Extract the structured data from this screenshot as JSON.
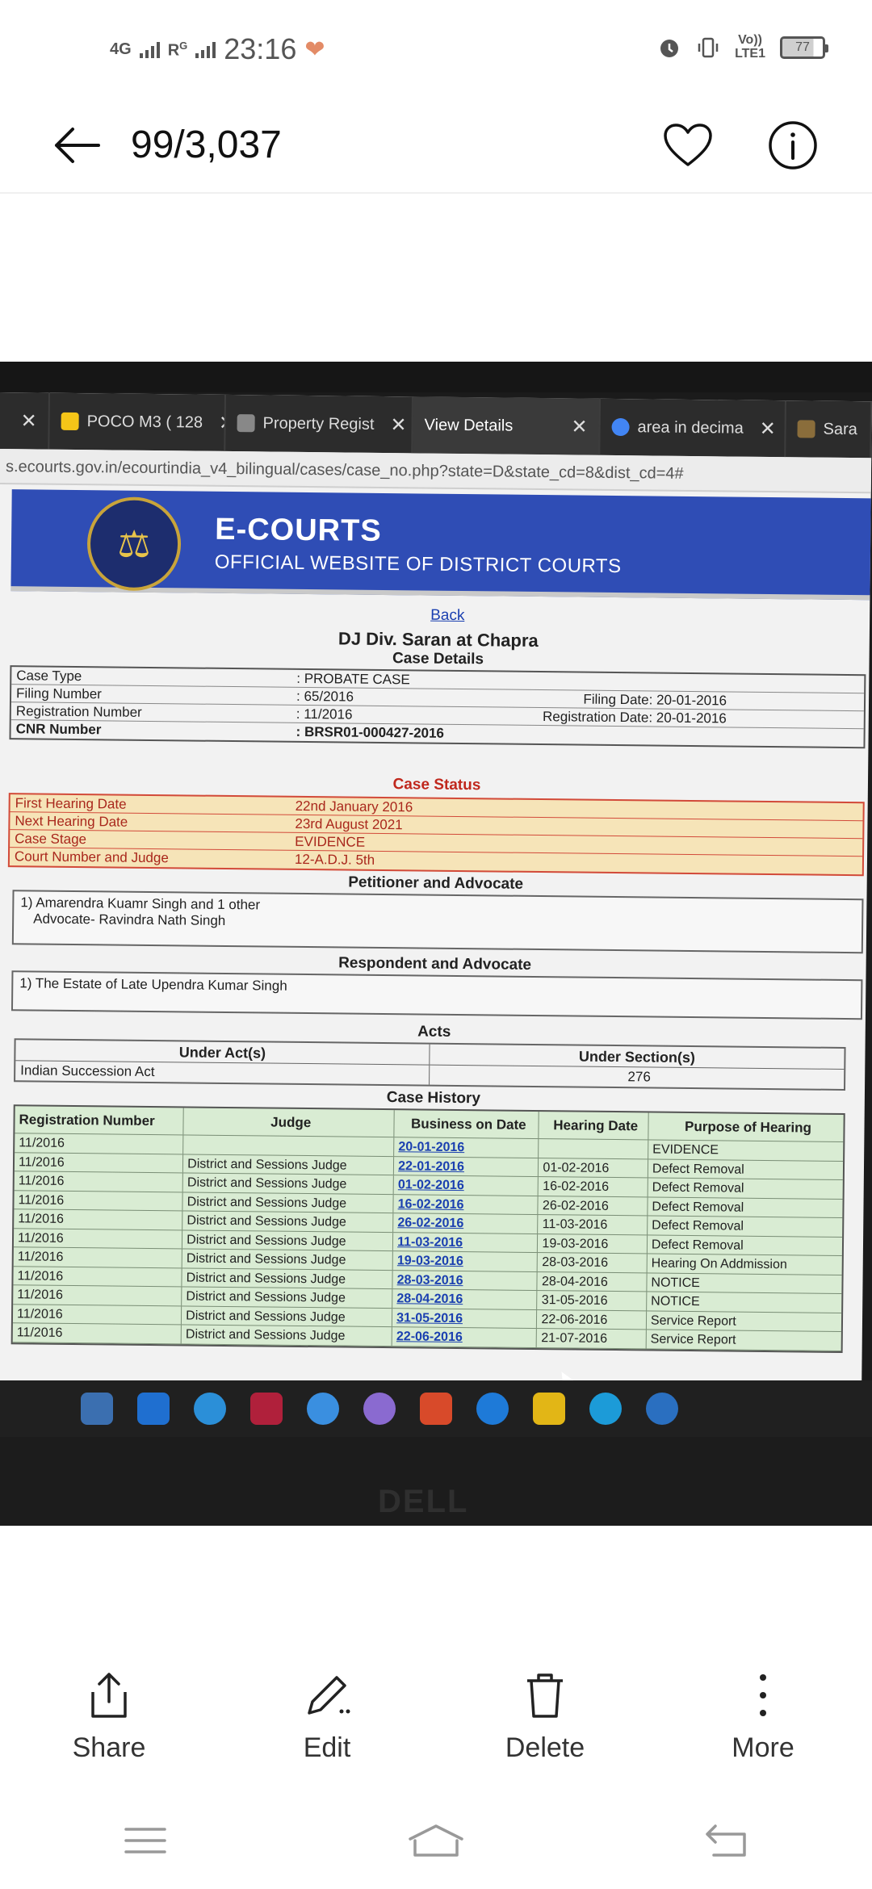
{
  "status_bar": {
    "network_left": "4G",
    "network_right": "R",
    "network_right_sup": "G",
    "time": "23:16",
    "volte_label_1": "Vo))",
    "volte_label_2": "LTE1",
    "battery": "77"
  },
  "header": {
    "counter": "99/3,037"
  },
  "photo": {
    "tabs": [
      {
        "label": "POCO M3 ( 128",
        "favicon_color": "#f5c518"
      },
      {
        "label": "Property Regist",
        "favicon_color": "#888888"
      },
      {
        "label": "View Details",
        "favicon_color": "#3a3a3a"
      },
      {
        "label": "area in decima",
        "favicon_color": "#4285f4"
      },
      {
        "label": "Sara",
        "favicon_color": "#8a6d3b"
      }
    ],
    "url": "s.ecourts.gov.in/ecourtindia_v4_bilingual/cases/case_no.php?state=D&state_cd=8&dist_cd=4#",
    "banner_title": "E-COURTS",
    "banner_subtitle": "OFFICIAL WEBSITE OF DISTRICT COURTS",
    "back_link": "Back",
    "court_name": "DJ Div. Saran at Chapra",
    "case_details_title": "Case Details",
    "case_details": [
      {
        "key": "Case Type",
        "value": ": PROBATE CASE",
        "extra": ""
      },
      {
        "key": "Filing Number",
        "value": ": 65/2016",
        "extra": "Filing Date: 20-01-2016"
      },
      {
        "key": "Registration Number",
        "value": ": 11/2016",
        "extra": "Registration Date: 20-01-2016"
      },
      {
        "key": "CNR Number",
        "value": ": BRSR01-000427-2016",
        "extra": ""
      }
    ],
    "case_status_title": "Case Status",
    "case_status": [
      {
        "key": "First Hearing Date",
        "value": "22nd January 2016"
      },
      {
        "key": "Next Hearing Date",
        "value": "23rd August 2021"
      },
      {
        "key": "Case Stage",
        "value": "EVIDENCE"
      },
      {
        "key": "Court Number and Judge",
        "value": "12-A.D.J. 5th"
      }
    ],
    "petitioner_title": "Petitioner and Advocate",
    "petitioner_line1": "1) Amarendra Kuamr Singh and 1 other",
    "petitioner_line2": "Advocate- Ravindra Nath Singh",
    "respondent_title": "Respondent and Advocate",
    "respondent_line1": "1) The Estate of Late Upendra Kumar Singh",
    "acts_title": "Acts",
    "acts_head_1": "Under Act(s)",
    "acts_head_2": "Under Section(s)",
    "acts_value_1": "Indian Succession Act",
    "acts_value_2": "276",
    "history_title": "Case History",
    "history_headers": [
      "Registration Number",
      "Judge",
      "Business on Date",
      "Hearing Date",
      "Purpose of Hearing"
    ],
    "history_rows": [
      {
        "reg": "11/2016",
        "judge": "",
        "business": "20-01-2016",
        "hearing": "",
        "purpose": "EVIDENCE"
      },
      {
        "reg": "11/2016",
        "judge": "District and Sessions Judge",
        "business": "22-01-2016",
        "hearing": "01-02-2016",
        "purpose": "Defect Removal"
      },
      {
        "reg": "11/2016",
        "judge": "District and Sessions Judge",
        "business": "01-02-2016",
        "hearing": "16-02-2016",
        "purpose": "Defect Removal"
      },
      {
        "reg": "11/2016",
        "judge": "District and Sessions Judge",
        "business": "16-02-2016",
        "hearing": "26-02-2016",
        "purpose": "Defect Removal"
      },
      {
        "reg": "11/2016",
        "judge": "District and Sessions Judge",
        "business": "26-02-2016",
        "hearing": "11-03-2016",
        "purpose": "Defect Removal"
      },
      {
        "reg": "11/2016",
        "judge": "District and Sessions Judge",
        "business": "11-03-2016",
        "hearing": "19-03-2016",
        "purpose": "Defect Removal"
      },
      {
        "reg": "11/2016",
        "judge": "District and Sessions Judge",
        "business": "19-03-2016",
        "hearing": "28-03-2016",
        "purpose": "Hearing On Addmission"
      },
      {
        "reg": "11/2016",
        "judge": "District and Sessions Judge",
        "business": "28-03-2016",
        "hearing": "28-04-2016",
        "purpose": "NOTICE"
      },
      {
        "reg": "11/2016",
        "judge": "District and Sessions Judge",
        "business": "28-04-2016",
        "hearing": "31-05-2016",
        "purpose": "NOTICE"
      },
      {
        "reg": "11/2016",
        "judge": "District and Sessions Judge",
        "business": "31-05-2016",
        "hearing": "22-06-2016",
        "purpose": "Service Report"
      },
      {
        "reg": "11/2016",
        "judge": "District and Sessions Judge",
        "business": "22-06-2016",
        "hearing": "21-07-2016",
        "purpose": "Service Report"
      }
    ],
    "bezel_logo": "DELL"
  },
  "actions": {
    "share": "Share",
    "edit": "Edit",
    "delete": "Delete",
    "more": "More"
  },
  "colors": {
    "accent_blue": "#2f4db5",
    "status_red": "#c0281d",
    "history_green": "#d9ecd3"
  }
}
